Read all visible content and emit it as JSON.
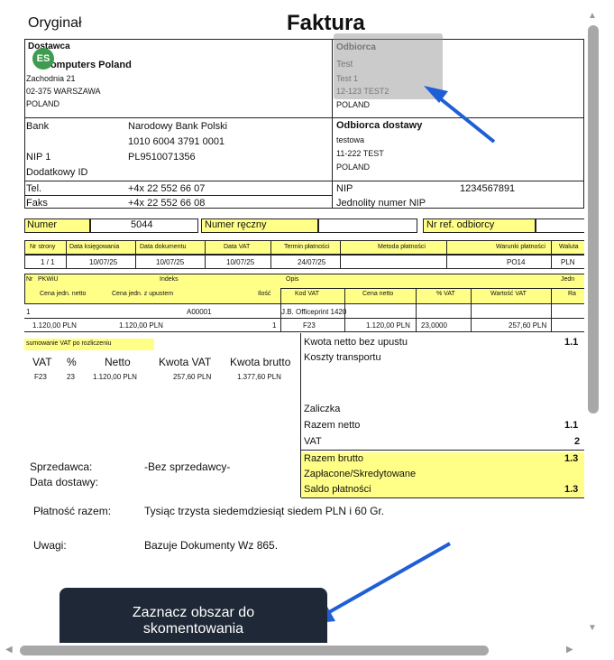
{
  "document": {
    "copy_label": "Oryginał",
    "title": "Faktura",
    "seller": {
      "heading": "Dostawca",
      "name": "Computers Poland",
      "street": "Zachodnia 21",
      "city": "02-375 WARSZAWA",
      "country": "POLAND"
    },
    "avatar_initials": "ES",
    "buyer": {
      "heading": "Odbiorca",
      "line1": "Test",
      "line2": "Test 1",
      "line3": "12-123 TEST2",
      "country": "POLAND"
    },
    "bank": {
      "label": "Bank",
      "name": "Narodowy Bank Polski",
      "account": "1010 6004 3791 0001",
      "nip_label": "NIP 1",
      "nip": "PL9510071356",
      "extra_label": "Dodatkowy ID"
    },
    "delivery": {
      "heading": "Odbiorca dostawy",
      "line1": "testowa",
      "line2": "11-222 TEST",
      "country": "POLAND"
    },
    "contact": {
      "tel_label": "Tel.",
      "tel": "+4x 22 552 66 07",
      "fax_label": "Faks",
      "fax": "+4x 22 552 66 08"
    },
    "nip_block": {
      "label": "NIP",
      "value": "1234567891",
      "unified_label": "Jednolity numer NIP"
    },
    "number_row": {
      "number_label": "Numer",
      "number": "5044",
      "manual_label": "Numer ręczny",
      "ref_label": "Nr ref. odbiorcy"
    },
    "meta_headers": [
      "Nr strony",
      "Data księgowania",
      "Data dokumentu",
      "Data VAT",
      "Termin płatności",
      "Metoda płatności",
      "Warunki płatności",
      "Waluta"
    ],
    "meta_values": [
      "1 / 1",
      "10/07/25",
      "10/07/25",
      "10/07/25",
      "24/07/25",
      "",
      "PO14",
      "PLN"
    ],
    "items_header1": [
      "Nr",
      "PKWiU",
      "Indeks",
      "Opis",
      "Jedn"
    ],
    "items_header2": [
      "Cena jedn. netto",
      "Cena jedn. z upustem",
      "Ilość",
      "Kod VAT",
      "Cena netto",
      "% VAT",
      "Wartość VAT",
      "Ra"
    ],
    "item1": {
      "nr": "1",
      "index": "A00001",
      "desc": "J.B. Officeprint 1420",
      "unit_net": "1.120,00 PLN",
      "unit_disc": "1.120,00 PLN",
      "qty": "1",
      "vat_code": "F23",
      "net": "1.120,00 PLN",
      "vat_pct": "23,0000",
      "vat_value": "257,60 PLN"
    },
    "vat_summary": {
      "heading": "sumowanie VAT po rozliczeniu",
      "headers": [
        "VAT",
        "%",
        "Netto",
        "Kwota VAT",
        "Kwota brutto"
      ],
      "row": [
        "F23",
        "23",
        "1.120,00 PLN",
        "257,60 PLN",
        "1.377,60 PLN"
      ]
    },
    "totals": {
      "net_wo_discount": "Kwota netto bez upustu",
      "net_wo_discount_val": "1.1",
      "transport": "Koszty transportu",
      "advance": "Zaliczka",
      "net_total": "Razem netto",
      "net_total_val": "1.1",
      "vat": "VAT",
      "vat_val": "2",
      "gross_total": "Razem brutto",
      "gross_total_val": "1.3",
      "paid": "Zapłacone/Skredytowane",
      "balance": "Saldo płatności",
      "balance_val": "1.3"
    },
    "seller_person_label": "Sprzedawca:",
    "seller_person": "-Bez sprzedawcy-",
    "delivery_date_label": "Data dostawy:",
    "payment_label": "Płatność razem:",
    "payment_words": "Tysiąc trzysta siedemdziesiąt siedem PLN i 60 Gr.",
    "notes_label": "Uwagi:",
    "notes": "Bazuje Dokumenty Wz 865."
  },
  "tooltip": {
    "line1": "Zaznacz obszar do",
    "line2": "skomentowania"
  },
  "colors": {
    "highlight": "#ffff88",
    "arrow": "#1f5fd6",
    "tooltip_bg": "#1e2836",
    "avatar": "#3e9b4f"
  }
}
